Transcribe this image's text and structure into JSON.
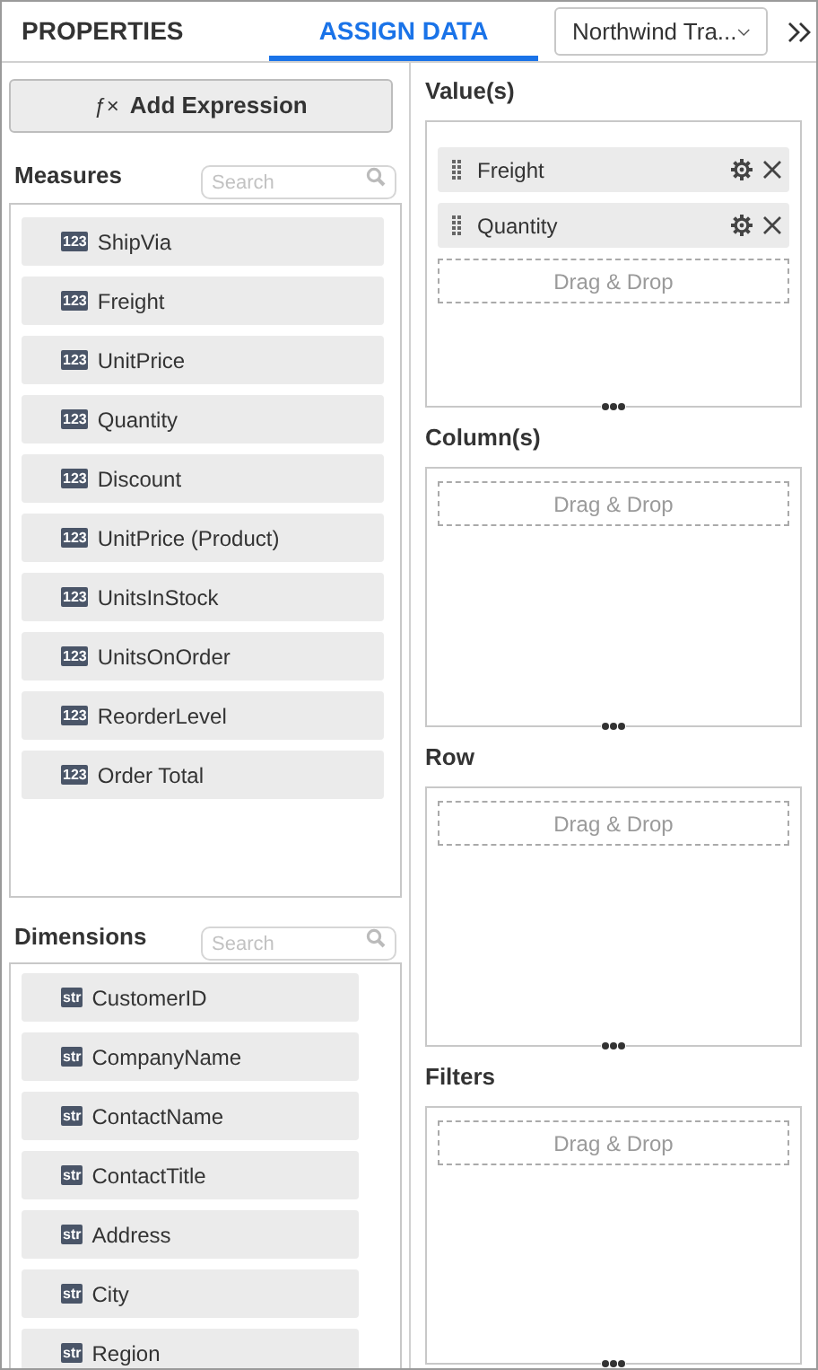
{
  "tabs": [
    {
      "label": "PROPERTIES",
      "selected": false
    },
    {
      "label": "ASSIGN DATA",
      "selected": true
    }
  ],
  "datasource": {
    "value": "Northwind Tra..."
  },
  "add_expression": {
    "icon": "ƒ×",
    "label": "Add Expression"
  },
  "measures": {
    "title": "Measures",
    "search_placeholder": "Search",
    "items": [
      {
        "badge": "123",
        "label": "ShipVia"
      },
      {
        "badge": "123",
        "label": "Freight"
      },
      {
        "badge": "123",
        "label": "UnitPrice"
      },
      {
        "badge": "123",
        "label": "Quantity"
      },
      {
        "badge": "123",
        "label": "Discount"
      },
      {
        "badge": "123",
        "label": "UnitPrice (Product)"
      },
      {
        "badge": "123",
        "label": "UnitsInStock"
      },
      {
        "badge": "123",
        "label": "UnitsOnOrder"
      },
      {
        "badge": "123",
        "label": "ReorderLevel"
      },
      {
        "badge": "123",
        "label": "Order Total"
      }
    ]
  },
  "dimensions": {
    "title": "Dimensions",
    "search_placeholder": "Search",
    "items": [
      {
        "badge": "str",
        "label": "CustomerID"
      },
      {
        "badge": "str",
        "label": "CompanyName"
      },
      {
        "badge": "str",
        "label": "ContactName"
      },
      {
        "badge": "str",
        "label": "ContactTitle"
      },
      {
        "badge": "str",
        "label": "Address"
      },
      {
        "badge": "str",
        "label": "City"
      },
      {
        "badge": "str",
        "label": "Region"
      }
    ]
  },
  "sections": [
    {
      "title": "Value(s)",
      "fields": [
        "Freight",
        "Quantity"
      ],
      "drop_hint": "Drag & Drop"
    },
    {
      "title": "Column(s)",
      "drop_hint": "Drag & Drop"
    },
    {
      "title": "Row",
      "drop_hint": "Drag & Drop"
    },
    {
      "title": "Filters",
      "drop_hint": "Drag & Drop"
    }
  ]
}
